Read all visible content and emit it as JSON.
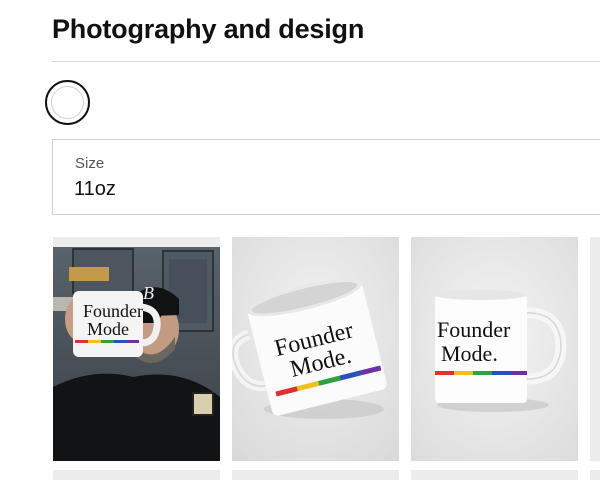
{
  "section": {
    "title": "Photography and design"
  },
  "color_options": [
    {
      "color": "#ffffff",
      "selected": true
    }
  ],
  "size_field": {
    "label": "Size",
    "value": "11oz"
  },
  "gallery": {
    "images": [
      {
        "mug_line1": "Founder",
        "mug_line2": "Mode",
        "cap_letter": "B"
      },
      {
        "mug_line1": "Founder",
        "mug_line2": "Mode."
      },
      {
        "mug_line1": "Founder",
        "mug_line2": "Mode."
      }
    ]
  }
}
